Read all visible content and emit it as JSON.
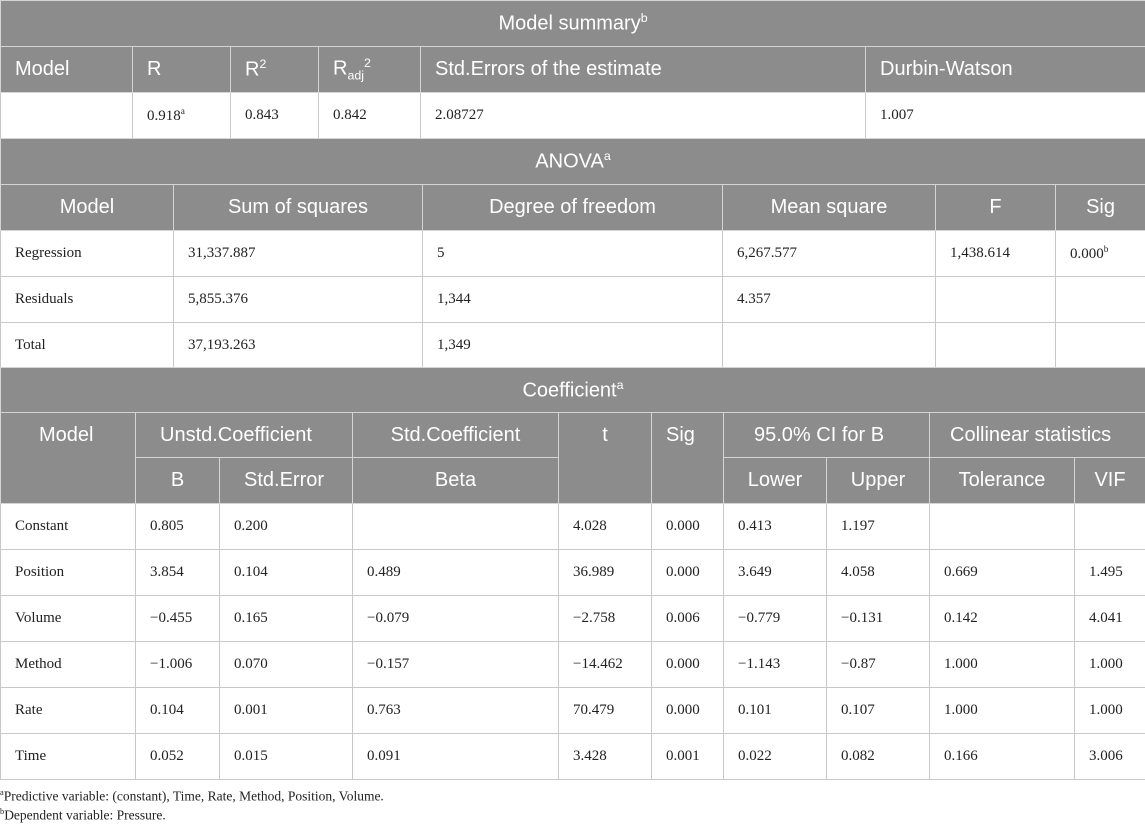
{
  "model_summary": {
    "title": "Model summary",
    "title_sup": "b",
    "headers": {
      "model": "Model",
      "r": "R",
      "r2_base": "R",
      "r2_sup": "2",
      "radj_base": "R",
      "radj_sub": "adj",
      "radj_sup": "2",
      "std_err": "Std.Errors of the estimate",
      "dw": "Durbin-Watson"
    },
    "row": {
      "model": "",
      "r": "0.918",
      "r_sup": "a",
      "r2": "0.843",
      "radj": "0.842",
      "std_err": "2.08727",
      "dw": "1.007"
    }
  },
  "anova": {
    "title": "ANOVA",
    "title_sup": "a",
    "headers": [
      "Model",
      "Sum of squares",
      "Degree of freedom",
      "Mean square",
      "F",
      "Sig"
    ],
    "rows": [
      {
        "model": "Regression",
        "ss": "31,337.887",
        "df": "5",
        "ms": "6,267.577",
        "f": "1,438.614",
        "sig": "0.000",
        "sig_sup": "b"
      },
      {
        "model": "Residuals",
        "ss": "5,855.376",
        "df": "1,344",
        "ms": "4.357",
        "f": "",
        "sig": "",
        "sig_sup": ""
      },
      {
        "model": "Total",
        "ss": "37,193.263",
        "df": "1,349",
        "ms": "",
        "f": "",
        "sig": "",
        "sig_sup": ""
      }
    ]
  },
  "coefficient": {
    "title": "Coefficient",
    "title_sup": "a",
    "headers": {
      "model": "Model",
      "unstd": "Unstd.Coefficient",
      "std": "Std.Coefficient",
      "t": "t",
      "sig": "Sig",
      "ci": "95.0% CI for B",
      "collinear": "Collinear statistics",
      "b": "B",
      "stderr": "Std.Error",
      "beta": "Beta",
      "lower": "Lower",
      "upper": "Upper",
      "tolerance": "Tolerance",
      "vif": "VIF"
    },
    "rows": [
      {
        "model": "Constant",
        "b": "0.805",
        "se": "0.200",
        "beta": "",
        "t": "4.028",
        "sig": "0.000",
        "lower": "0.413",
        "upper": "1.197",
        "tol": "",
        "vif": ""
      },
      {
        "model": "Position",
        "b": "3.854",
        "se": "0.104",
        "beta": "0.489",
        "t": "36.989",
        "sig": "0.000",
        "lower": "3.649",
        "upper": "4.058",
        "tol": "0.669",
        "vif": "1.495"
      },
      {
        "model": "Volume",
        "b": "−0.455",
        "se": "0.165",
        "beta": "−0.079",
        "t": "−2.758",
        "sig": "0.006",
        "lower": "−0.779",
        "upper": "−0.131",
        "tol": "0.142",
        "vif": "4.041"
      },
      {
        "model": "Method",
        "b": "−1.006",
        "se": "0.070",
        "beta": "−0.157",
        "t": "−14.462",
        "sig": "0.000",
        "lower": "−1.143",
        "upper": "−0.87",
        "tol": "1.000",
        "vif": "1.000"
      },
      {
        "model": "Rate",
        "b": "0.104",
        "se": "0.001",
        "beta": "0.763",
        "t": "70.479",
        "sig": "0.000",
        "lower": "0.101",
        "upper": "0.107",
        "tol": "1.000",
        "vif": "1.000"
      },
      {
        "model": "Time",
        "b": "0.052",
        "se": "0.015",
        "beta": "0.091",
        "t": "3.428",
        "sig": "0.001",
        "lower": "0.022",
        "upper": "0.082",
        "tol": "0.166",
        "vif": "3.006"
      }
    ]
  },
  "footnotes": [
    {
      "mark": "a",
      "text": "Predictive variable: (constant), Time, Rate, Method, Position, Volume."
    },
    {
      "mark": "b",
      "text": "Dependent variable: Pressure."
    }
  ]
}
